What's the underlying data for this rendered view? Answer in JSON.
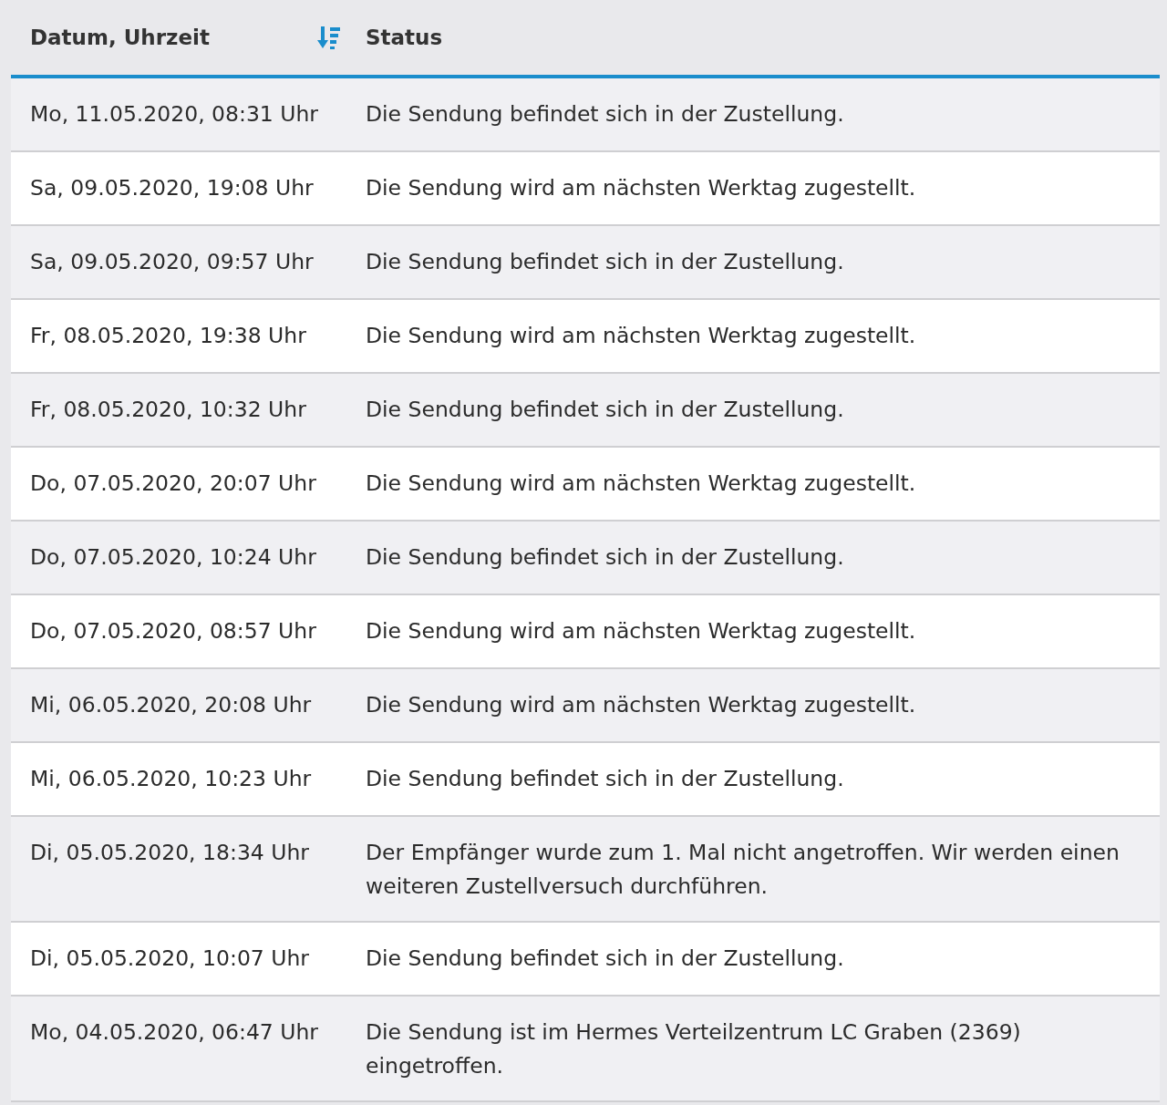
{
  "table": {
    "columns": [
      {
        "label": "Datum, Uhrzeit",
        "sorted": true
      },
      {
        "label": "Status",
        "sorted": false
      }
    ],
    "rows": [
      {
        "date": "Mo, 11.05.2020, 08:31 Uhr",
        "status": "Die Sendung befindet sich in der Zustellung."
      },
      {
        "date": "Sa, 09.05.2020, 19:08 Uhr",
        "status": "Die Sendung wird am nächsten Werktag zugestellt."
      },
      {
        "date": "Sa, 09.05.2020, 09:57 Uhr",
        "status": "Die Sendung befindet sich in der Zustellung."
      },
      {
        "date": "Fr, 08.05.2020, 19:38 Uhr",
        "status": "Die Sendung wird am nächsten Werktag zugestellt."
      },
      {
        "date": "Fr, 08.05.2020, 10:32 Uhr",
        "status": "Die Sendung befindet sich in der Zustellung."
      },
      {
        "date": "Do, 07.05.2020, 20:07 Uhr",
        "status": "Die Sendung wird am nächsten Werktag zugestellt."
      },
      {
        "date": "Do, 07.05.2020, 10:24 Uhr",
        "status": "Die Sendung befindet sich in der Zustellung."
      },
      {
        "date": "Do, 07.05.2020, 08:57 Uhr",
        "status": "Die Sendung wird am nächsten Werktag zugestellt."
      },
      {
        "date": "Mi, 06.05.2020, 20:08 Uhr",
        "status": "Die Sendung wird am nächsten Werktag zugestellt."
      },
      {
        "date": "Mi, 06.05.2020, 10:23 Uhr",
        "status": "Die Sendung befindet sich in der Zustellung."
      },
      {
        "date": "Di, 05.05.2020, 18:34 Uhr",
        "status": "Der Empfänger wurde zum 1. Mal nicht angetroffen. Wir werden einen weiteren Zustellversuch durchführen."
      },
      {
        "date": "Di, 05.05.2020, 10:07 Uhr",
        "status": "Die Sendung befindet sich in der Zustellung."
      },
      {
        "date": "Mo, 04.05.2020, 06:47 Uhr",
        "status": "Die Sendung ist im Hermes Verteilzentrum LC Graben (2369) eingetroffen."
      }
    ]
  }
}
